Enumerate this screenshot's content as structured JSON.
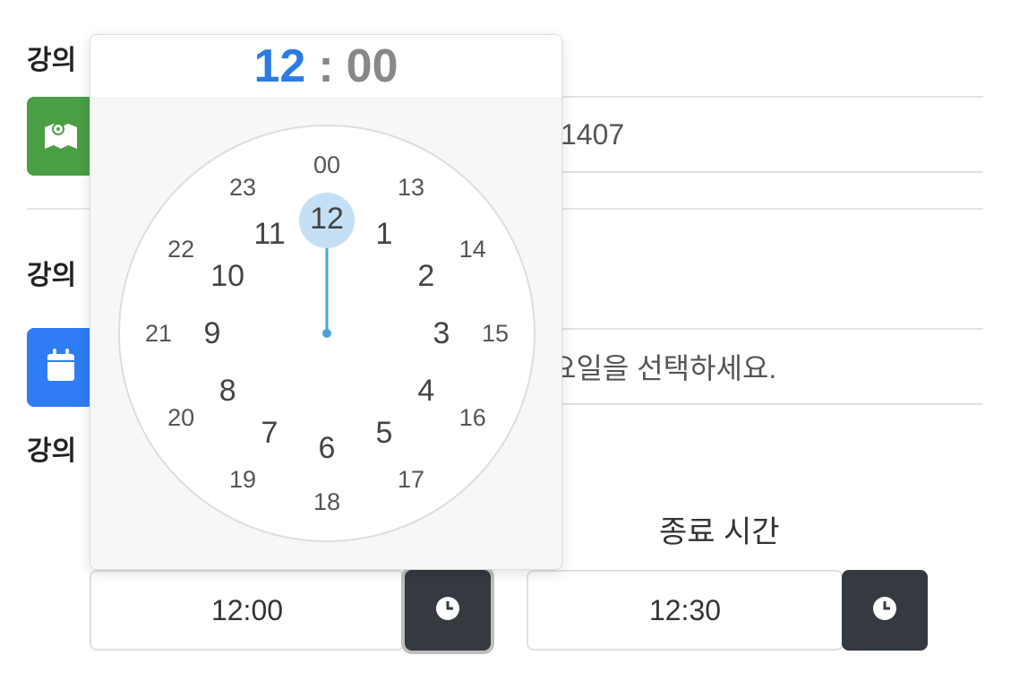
{
  "form": {
    "label_location": "강의",
    "label_day": "강의",
    "label_time": "강의",
    "location_value": "1407",
    "day_placeholder": "요일을 선택하세요.",
    "end_time_label": "종료 시간",
    "start_time_value": "12:00",
    "end_time_value": "12:30"
  },
  "colors": {
    "map_button": "#4a9f45",
    "calendar_button": "#2f7cf6",
    "clock_button": "#343a40",
    "selected_hour": "#2c7be5"
  },
  "icons": {
    "location": "map-icon",
    "day": "calendar-icon",
    "time": "clock-icon"
  },
  "clockpicker": {
    "header_hour": "12",
    "header_separator": ":",
    "header_minute": "00",
    "selected_hour": "12",
    "inner_hours": [
      "12",
      "1",
      "2",
      "3",
      "4",
      "5",
      "6",
      "7",
      "8",
      "9",
      "10",
      "11"
    ],
    "outer_hours": [
      "00",
      "13",
      "14",
      "15",
      "16",
      "17",
      "18",
      "19",
      "20",
      "21",
      "22",
      "23"
    ]
  }
}
